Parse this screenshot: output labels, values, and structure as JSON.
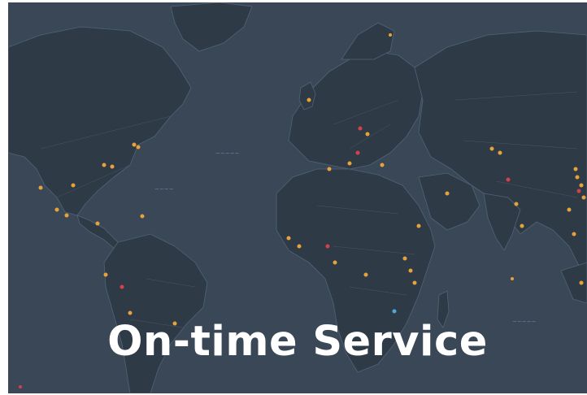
{
  "caption": {
    "text": "On-time Service"
  },
  "map": {
    "style": "dark-basemap",
    "colors": {
      "ocean": "#3a4756",
      "land": "#2f3a47",
      "coast": "#4f6478",
      "marker_orange": "#e8a23a",
      "marker_red": "#d6404a"
    },
    "marker_count": 48
  }
}
